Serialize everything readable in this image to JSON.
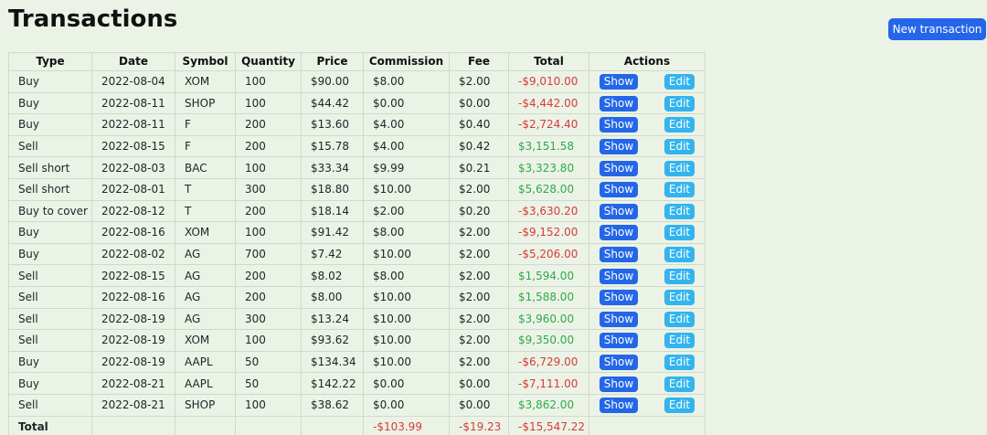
{
  "page": {
    "title": "Transactions",
    "new_button_label": "New transaction"
  },
  "table": {
    "columns": [
      "Type",
      "Date",
      "Symbol",
      "Quantity",
      "Price",
      "Commission",
      "Fee",
      "Total",
      "Actions"
    ],
    "action_labels": {
      "show": "Show",
      "edit": "Edit"
    },
    "rows": [
      {
        "type": "Buy",
        "date": "2022-08-04",
        "symbol": "XOM",
        "quantity": "100",
        "price": "$90.00",
        "commission": "$8.00",
        "fee": "$2.00",
        "total": "-$9,010.00"
      },
      {
        "type": "Buy",
        "date": "2022-08-11",
        "symbol": "SHOP",
        "quantity": "100",
        "price": "$44.42",
        "commission": "$0.00",
        "fee": "$0.00",
        "total": "-$4,442.00"
      },
      {
        "type": "Buy",
        "date": "2022-08-11",
        "symbol": "F",
        "quantity": "200",
        "price": "$13.60",
        "commission": "$4.00",
        "fee": "$0.40",
        "total": "-$2,724.40"
      },
      {
        "type": "Sell",
        "date": "2022-08-15",
        "symbol": "F",
        "quantity": "200",
        "price": "$15.78",
        "commission": "$4.00",
        "fee": "$0.42",
        "total": "$3,151.58"
      },
      {
        "type": "Sell short",
        "date": "2022-08-03",
        "symbol": "BAC",
        "quantity": "100",
        "price": "$33.34",
        "commission": "$9.99",
        "fee": "$0.21",
        "total": "$3,323.80"
      },
      {
        "type": "Sell short",
        "date": "2022-08-01",
        "symbol": "T",
        "quantity": "300",
        "price": "$18.80",
        "commission": "$10.00",
        "fee": "$2.00",
        "total": "$5,628.00"
      },
      {
        "type": "Buy to cover",
        "date": "2022-08-12",
        "symbol": "T",
        "quantity": "200",
        "price": "$18.14",
        "commission": "$2.00",
        "fee": "$0.20",
        "total": "-$3,630.20"
      },
      {
        "type": "Buy",
        "date": "2022-08-16",
        "symbol": "XOM",
        "quantity": "100",
        "price": "$91.42",
        "commission": "$8.00",
        "fee": "$2.00",
        "total": "-$9,152.00"
      },
      {
        "type": "Buy",
        "date": "2022-08-02",
        "symbol": "AG",
        "quantity": "700",
        "price": "$7.42",
        "commission": "$10.00",
        "fee": "$2.00",
        "total": "-$5,206.00"
      },
      {
        "type": "Sell",
        "date": "2022-08-15",
        "symbol": "AG",
        "quantity": "200",
        "price": "$8.02",
        "commission": "$8.00",
        "fee": "$2.00",
        "total": "$1,594.00"
      },
      {
        "type": "Sell",
        "date": "2022-08-16",
        "symbol": "AG",
        "quantity": "200",
        "price": "$8.00",
        "commission": "$10.00",
        "fee": "$2.00",
        "total": "$1,588.00"
      },
      {
        "type": "Sell",
        "date": "2022-08-19",
        "symbol": "AG",
        "quantity": "300",
        "price": "$13.24",
        "commission": "$10.00",
        "fee": "$2.00",
        "total": "$3,960.00"
      },
      {
        "type": "Sell",
        "date": "2022-08-19",
        "symbol": "XOM",
        "quantity": "100",
        "price": "$93.62",
        "commission": "$10.00",
        "fee": "$2.00",
        "total": "$9,350.00"
      },
      {
        "type": "Buy",
        "date": "2022-08-19",
        "symbol": "AAPL",
        "quantity": "50",
        "price": "$134.34",
        "commission": "$10.00",
        "fee": "$2.00",
        "total": "-$6,729.00"
      },
      {
        "type": "Buy",
        "date": "2022-08-21",
        "symbol": "AAPL",
        "quantity": "50",
        "price": "$142.22",
        "commission": "$0.00",
        "fee": "$0.00",
        "total": "-$7,111.00"
      },
      {
        "type": "Sell",
        "date": "2022-08-21",
        "symbol": "SHOP",
        "quantity": "100",
        "price": "$38.62",
        "commission": "$0.00",
        "fee": "$0.00",
        "total": "$3,862.00"
      }
    ],
    "totals": {
      "label": "Total",
      "commission": "-$103.99",
      "fee": "-$19.23",
      "total": "-$15,547.22"
    }
  },
  "colors": {
    "background": "#ebf3e6",
    "primary_button": "#2466e8",
    "info_button": "#33b4ee",
    "negative": "#d93a3a",
    "positive": "#2eaa4a"
  }
}
